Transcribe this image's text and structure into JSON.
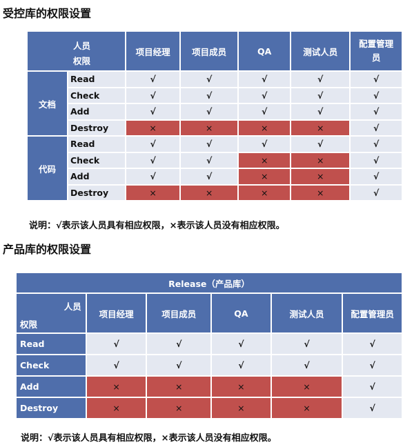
{
  "section1": {
    "title": "受控库的权限设置",
    "corner_top": "人员",
    "corner_bottom": "权限",
    "columns": [
      "项目经理",
      "项目成员",
      "QA",
      "测试人员",
      "配置管理员"
    ],
    "groups": [
      {
        "name": "文档",
        "rows": [
          {
            "label": "Read",
            "cells": [
              "√",
              "√",
              "√",
              "√",
              "√"
            ]
          },
          {
            "label": "Check",
            "cells": [
              "√",
              "√",
              "√",
              "√",
              "√"
            ]
          },
          {
            "label": "Add",
            "cells": [
              "√",
              "√",
              "√",
              "√",
              "√"
            ]
          },
          {
            "label": "Destroy",
            "cells": [
              "×",
              "×",
              "×",
              "×",
              "√"
            ]
          }
        ]
      },
      {
        "name": "代码",
        "rows": [
          {
            "label": "Read",
            "cells": [
              "√",
              "√",
              "√",
              "√",
              "√"
            ]
          },
          {
            "label": "Check",
            "cells": [
              "√",
              "√",
              "×",
              "×",
              "√"
            ]
          },
          {
            "label": "Add",
            "cells": [
              "√",
              "√",
              "×",
              "×",
              "√"
            ]
          },
          {
            "label": "Destroy",
            "cells": [
              "×",
              "×",
              "×",
              "×",
              "√"
            ]
          }
        ]
      }
    ],
    "note": "说明：√表示该人员具有相应权限，×表示该人员没有相应权限。"
  },
  "section2": {
    "title": "产品库的权限设置",
    "banner": "Release（产品库）",
    "corner_top": "人员",
    "corner_bottom": "权限",
    "columns": [
      "项目经理",
      "项目成员",
      "QA",
      "测试人员",
      "配置管理员"
    ],
    "rows": [
      {
        "label": "Read",
        "cells": [
          "√",
          "√",
          "√",
          "√",
          "√"
        ]
      },
      {
        "label": "Check",
        "cells": [
          "√",
          "√",
          "√",
          "√",
          "√"
        ]
      },
      {
        "label": "Add",
        "cells": [
          "×",
          "×",
          "×",
          "×",
          "√"
        ]
      },
      {
        "label": "Destroy",
        "cells": [
          "×",
          "×",
          "×",
          "×",
          "√"
        ]
      }
    ],
    "note": "说明：√表示该人员具有相应权限，×表示该人员没有相应权限。"
  },
  "colors": {
    "header_blue": "#4f6eab",
    "cell_light": "#e4e8f1",
    "deny_red": "#c0504d"
  }
}
